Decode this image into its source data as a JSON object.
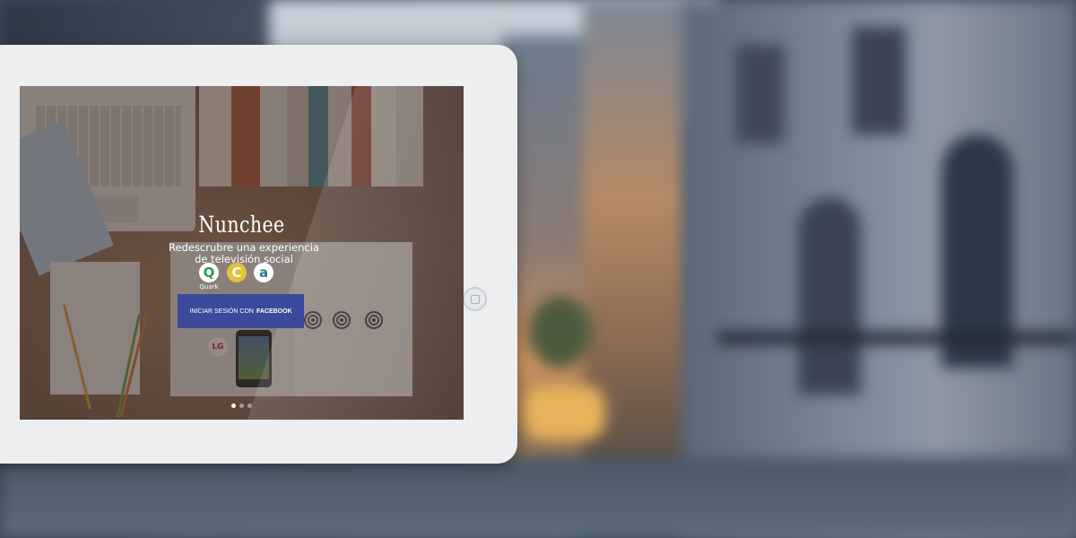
{
  "app": {
    "logo_text": "Nunchee",
    "tagline_line1": "Redescrubre una experiencia",
    "tagline_line2": "de televisión social"
  },
  "brands": [
    {
      "name": "Quark",
      "icon": "quark-icon",
      "color": "#2e9a48"
    },
    {
      "name": "",
      "icon": "c-logo-icon",
      "color": "#e3c23a"
    },
    {
      "name": "",
      "icon": "a-logo-icon",
      "color": "#2a7d8c"
    }
  ],
  "login_button": {
    "prefix": "INICIAR SESIÓN CON",
    "provider": "FACEBOOK",
    "color": "#3b4a9a"
  },
  "carousel": {
    "total": 3,
    "active_index": 0
  },
  "colors": {
    "tablet_frame": "#eceef0",
    "overlay": "rgba(60,44,38,.55)"
  }
}
